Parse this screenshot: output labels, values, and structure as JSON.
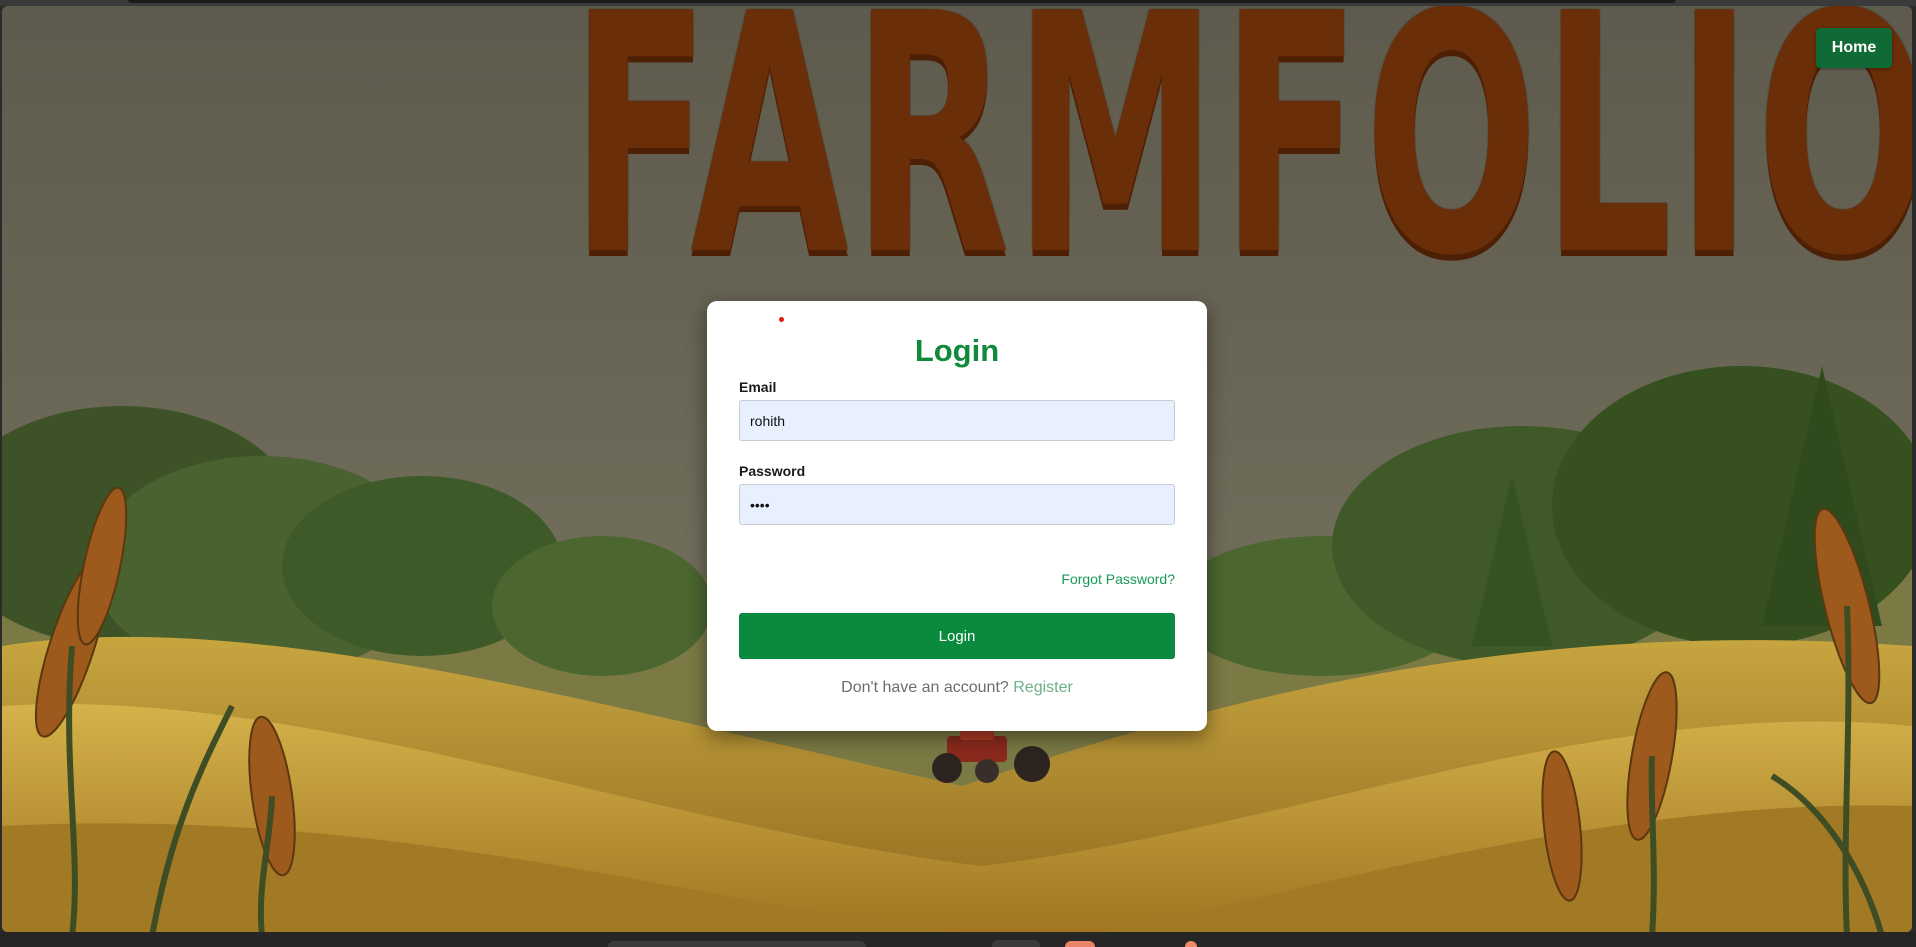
{
  "header": {
    "brand": "FARMFOLIO",
    "home_button": "Home"
  },
  "login": {
    "title": "Login",
    "email_label": "Email",
    "email_value": "rohith",
    "password_label": "Password",
    "password_value": "rohi",
    "forgot_link": "Forgot Password?",
    "submit_label": "Login",
    "register_prompt": "Don't have an account?",
    "register_link": "Register"
  },
  "colors": {
    "primary_green": "#0a8a3c",
    "title_green": "#118a3b",
    "home_button_bg": "#0f6a35",
    "input_bg": "#e8f0fe"
  }
}
